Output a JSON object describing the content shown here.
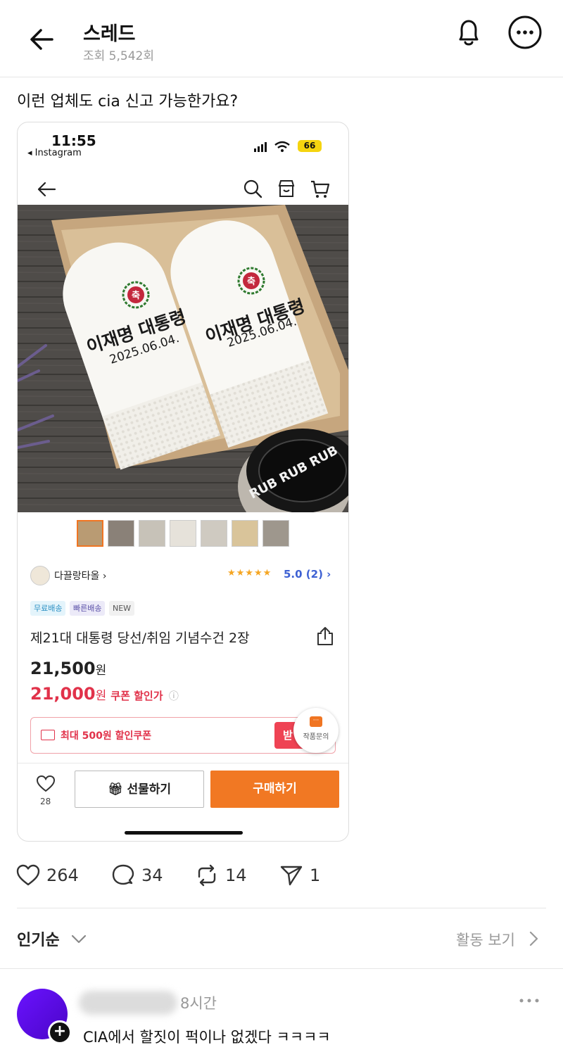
{
  "header": {
    "title": "스레드",
    "views": "조회 5,542회"
  },
  "post": {
    "text": "이런 업체도 cia 신고 가능한가요?"
  },
  "embedded": {
    "status_bar": {
      "time": "11:55",
      "back_app": "◂ Instagram",
      "battery": "66"
    },
    "product": {
      "embroidery_mark": "축",
      "embroidery_line1": "이재명 대통령",
      "embroidery_line2": "2025.06.04.",
      "jar_label": "RUB RUB RUB",
      "seller": "다끌랑타올",
      "stars": "★★★★★",
      "rating": "5.0 (2) ›",
      "badges": [
        "무료배송",
        "빠른배송",
        "NEW"
      ],
      "name": "제21대 대통령 당선/취임 기념수건 2장",
      "price": "21,500",
      "price_unit": "원",
      "coupon_price": "21,000",
      "coupon_price_unit": "원",
      "coupon_label": "쿠폰 할인가",
      "info_icon": "ⓘ",
      "coupon_text": "최대 500원 할인쿠폰",
      "coupon_button": "받",
      "inquiry_label": "작품문의",
      "like_count": "28",
      "gift_label": "선물하기",
      "buy_label": "구매하기"
    }
  },
  "actions": {
    "likes": "264",
    "comments": "34",
    "reposts": "14",
    "shares": "1"
  },
  "sort": {
    "label": "인기순",
    "activity": "활동 보기"
  },
  "comment": {
    "time": "8시간",
    "text": "CIA에서 할짓이 퍽이나 없겠다 ㅋㅋㅋㅋ"
  },
  "colors": {
    "accent_orange": "#f17823",
    "price_red": "#e1324a",
    "rating_blue": "#3e61d3",
    "avatar_purple": "#5a0ae0"
  }
}
